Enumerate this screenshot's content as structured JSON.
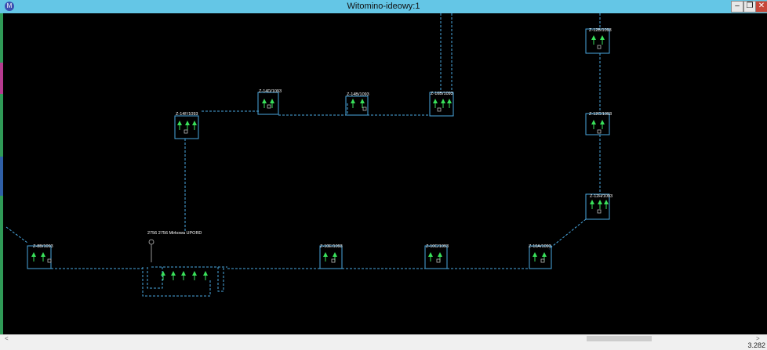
{
  "window": {
    "title": "Witomino-ideowy:1",
    "app_icon": "M",
    "min_glyph": "–",
    "max_glyph": "❐",
    "close_glyph": "✕"
  },
  "colors": {
    "background": "#000000",
    "line": "#4aa8e0",
    "arrow": "#39e05a",
    "title_bar": "#64c6e6"
  },
  "diagram": {
    "source_label": "2756 2756 Mirkowa UPORD",
    "stations": [
      "Z-12B/1093",
      "Z-14D/1093",
      "Z-14B/1093",
      "Z-16B/1093",
      "Z-14F/1093",
      "Z-12C/1093",
      "Z-12H/1093",
      "Z-8B/1093",
      "Z-10E/1093",
      "Z-10C/1093",
      "Z-10A/1093"
    ]
  },
  "scrollbar": {
    "left_arrow": "<",
    "right_arrow": ">"
  },
  "status": {
    "value": "3.282"
  }
}
